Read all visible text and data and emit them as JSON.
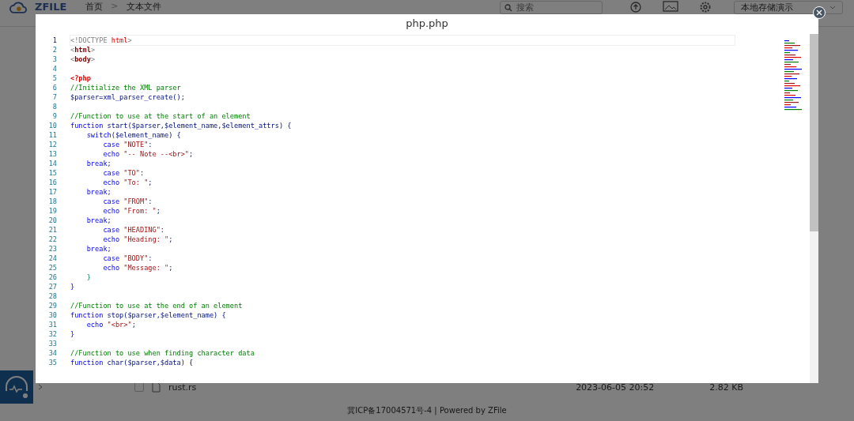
{
  "header": {
    "logo": "ZFILE",
    "breadcrumbs": [
      {
        "label": "首页"
      },
      {
        "label": "文本文件"
      }
    ],
    "separator": ">",
    "search": {
      "placeholder": "搜索"
    },
    "storage_select": {
      "value": "本地存储演示"
    }
  },
  "file_row": {
    "checked": false,
    "name": "rust.rs",
    "date": "2023-06-05 20:52",
    "size": "2.82 KB"
  },
  "footer": "冀ICP备17004571号-4 | Powered by ZFile",
  "dialog": {
    "title": "php.php",
    "lines": [
      {
        "number": "1",
        "selected": true,
        "tokens": [
          {
            "kind": "punct",
            "text": "<!DOCTYPE "
          },
          {
            "kind": "attr",
            "text": "html"
          },
          {
            "kind": "punct",
            "text": ">"
          }
        ]
      },
      {
        "number": "2",
        "selected": false,
        "tokens": [
          {
            "kind": "punct",
            "text": "<"
          },
          {
            "kind": "tag",
            "text": "html"
          },
          {
            "kind": "punct",
            "text": ">"
          }
        ]
      },
      {
        "number": "3",
        "selected": false,
        "tokens": [
          {
            "kind": "punct",
            "text": "<"
          },
          {
            "kind": "tag",
            "text": "body"
          },
          {
            "kind": "punct",
            "text": ">"
          }
        ]
      },
      {
        "number": "4",
        "selected": false
      },
      {
        "number": "5",
        "selected": false,
        "tokens": [
          {
            "kind": "php",
            "text": "<?php"
          }
        ]
      },
      {
        "number": "6",
        "selected": false,
        "tokens": [
          {
            "kind": "comment",
            "text": "//Initialize the XML parser"
          }
        ]
      },
      {
        "number": "7",
        "selected": false,
        "tokens": [
          {
            "kind": "plain",
            "text": "$parser=xml_parser_create();"
          }
        ]
      },
      {
        "number": "8",
        "selected": false
      },
      {
        "number": "9",
        "selected": false,
        "tokens": [
          {
            "kind": "comment",
            "text": "//Function to use at the start of an element"
          }
        ]
      },
      {
        "number": "10",
        "selected": false,
        "tokens": [
          {
            "kind": "keyword",
            "text": "function "
          },
          {
            "kind": "plain",
            "text": "start($parser,$element_name,$element_attrs) {"
          }
        ]
      },
      {
        "number": "11",
        "selected": false,
        "tokens": [
          {
            "kind": "keyword",
            "text": "    switch"
          },
          {
            "kind": "plain",
            "text": "($element_name) {"
          }
        ]
      },
      {
        "number": "12",
        "selected": false,
        "tokens": [
          {
            "kind": "keyword",
            "text": "        case "
          },
          {
            "kind": "string",
            "text": "\"NOTE\""
          },
          {
            "kind": "plain",
            "text": ":"
          }
        ]
      },
      {
        "number": "13",
        "selected": false,
        "tokens": [
          {
            "kind": "keyword",
            "text": "        echo "
          },
          {
            "kind": "string",
            "text": "\"-- Note --<br>\""
          },
          {
            "kind": "plain",
            "text": ";"
          }
        ]
      },
      {
        "number": "14",
        "selected": false,
        "tokens": [
          {
            "kind": "keyword",
            "text": "    break"
          },
          {
            "kind": "plain",
            "text": ";"
          }
        ]
      },
      {
        "number": "15",
        "selected": false,
        "tokens": [
          {
            "kind": "keyword",
            "text": "        case "
          },
          {
            "kind": "string",
            "text": "\"TO\""
          },
          {
            "kind": "plain",
            "text": ":"
          }
        ]
      },
      {
        "number": "16",
        "selected": false,
        "tokens": [
          {
            "kind": "keyword",
            "text": "        echo "
          },
          {
            "kind": "string",
            "text": "\"To: \""
          },
          {
            "kind": "plain",
            "text": ";"
          }
        ]
      },
      {
        "number": "17",
        "selected": false,
        "tokens": [
          {
            "kind": "keyword",
            "text": "    break"
          },
          {
            "kind": "plain",
            "text": ";"
          }
        ]
      },
      {
        "number": "18",
        "selected": false,
        "tokens": [
          {
            "kind": "keyword",
            "text": "        case "
          },
          {
            "kind": "string",
            "text": "\"FROM\""
          },
          {
            "kind": "plain",
            "text": ":"
          }
        ]
      },
      {
        "number": "19",
        "selected": false,
        "tokens": [
          {
            "kind": "keyword",
            "text": "        echo "
          },
          {
            "kind": "string",
            "text": "\"From: \""
          },
          {
            "kind": "plain",
            "text": ";"
          }
        ]
      },
      {
        "number": "20",
        "selected": false,
        "tokens": [
          {
            "kind": "keyword",
            "text": "    break"
          },
          {
            "kind": "plain",
            "text": ";"
          }
        ]
      },
      {
        "number": "21",
        "selected": false,
        "tokens": [
          {
            "kind": "keyword",
            "text": "        case "
          },
          {
            "kind": "string",
            "text": "\"HEADING\""
          },
          {
            "kind": "plain",
            "text": ":"
          }
        ]
      },
      {
        "number": "22",
        "selected": false,
        "tokens": [
          {
            "kind": "keyword",
            "text": "        echo "
          },
          {
            "kind": "string",
            "text": "\"Heading: \""
          },
          {
            "kind": "plain",
            "text": ";"
          }
        ]
      },
      {
        "number": "23",
        "selected": false,
        "tokens": [
          {
            "kind": "keyword",
            "text": "    break"
          },
          {
            "kind": "plain",
            "text": ";"
          }
        ]
      },
      {
        "number": "24",
        "selected": false,
        "tokens": [
          {
            "kind": "keyword",
            "text": "        case "
          },
          {
            "kind": "string",
            "text": "\"BODY\""
          },
          {
            "kind": "plain",
            "text": ":"
          }
        ]
      },
      {
        "number": "25",
        "selected": false,
        "tokens": [
          {
            "kind": "keyword",
            "text": "        echo "
          },
          {
            "kind": "string",
            "text": "\"Message: \""
          },
          {
            "kind": "plain",
            "text": ";"
          }
        ]
      },
      {
        "number": "26",
        "selected": false,
        "tokens": [
          {
            "kind": "brace",
            "text": "    }"
          }
        ]
      },
      {
        "number": "27",
        "selected": false,
        "tokens": [
          {
            "kind": "keyword",
            "text": "}"
          }
        ]
      },
      {
        "number": "28",
        "selected": false
      },
      {
        "number": "29",
        "selected": false,
        "tokens": [
          {
            "kind": "comment",
            "text": "//Function to use at the end of an element"
          }
        ]
      },
      {
        "number": "30",
        "selected": false,
        "tokens": [
          {
            "kind": "keyword",
            "text": "function "
          },
          {
            "kind": "plain",
            "text": "stop($parser,$element_name) {"
          }
        ]
      },
      {
        "number": "31",
        "selected": false,
        "tokens": [
          {
            "kind": "keyword",
            "text": "    echo "
          },
          {
            "kind": "string",
            "text": "\"<br>\""
          },
          {
            "kind": "plain",
            "text": ";"
          }
        ]
      },
      {
        "number": "32",
        "selected": false,
        "tokens": [
          {
            "kind": "keyword",
            "text": "}"
          }
        ]
      },
      {
        "number": "33",
        "selected": false
      },
      {
        "number": "34",
        "selected": false,
        "tokens": [
          {
            "kind": "comment",
            "text": "//Function to use when finding character data"
          }
        ]
      },
      {
        "number": "35",
        "selected": false,
        "tokens": [
          {
            "kind": "keyword",
            "text": "function "
          },
          {
            "kind": "plain",
            "text": "char($parser,$data) {"
          }
        ]
      }
    ]
  }
}
